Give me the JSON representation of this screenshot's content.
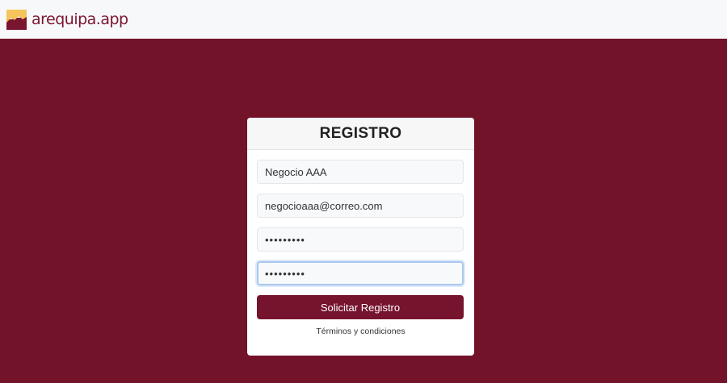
{
  "header": {
    "brand": "arequipa.app",
    "logo_icon": "mountain-sun-logo"
  },
  "colors": {
    "brand": "#721329",
    "button": "#76132d",
    "topbar": "#f7f8fa",
    "focus_border": "#a9c8ef"
  },
  "register": {
    "title": "REGISTRO",
    "business_name_value": "Negocio AAA",
    "email_value": "negocioaaa@correo.com",
    "password_value": "•••••••••",
    "confirm_password_value": "•••••••••",
    "submit_label": "Solicitar Registro",
    "terms_label": "Términos y condiciones"
  }
}
